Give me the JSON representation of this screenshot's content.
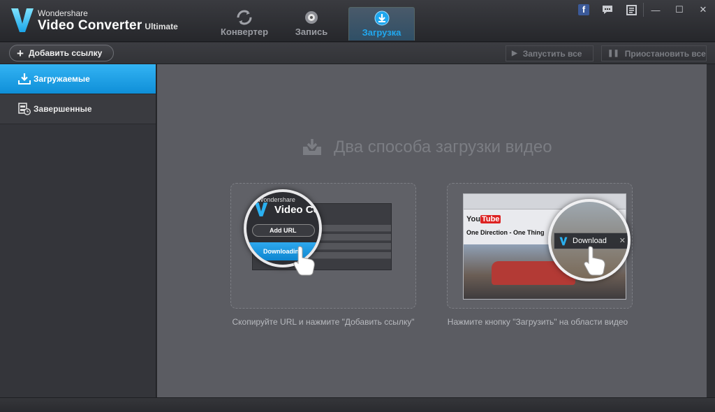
{
  "window": {
    "brand_small": "Wondershare",
    "brand_big": "Video Converter",
    "brand_edition": "Ultimate",
    "controls": {
      "facebook": "f",
      "minimize": "—",
      "maximize": "☐",
      "close": "✕"
    }
  },
  "tabs": [
    {
      "label": "Конвертер",
      "icon": "convert-icon",
      "active": false
    },
    {
      "label": "Запись",
      "icon": "record-icon",
      "active": false
    },
    {
      "label": "Загрузка",
      "icon": "download-icon",
      "active": true
    }
  ],
  "toolbar": {
    "add_link_label": "Добавить ссылку",
    "start_all_label": "Запустить все",
    "pause_all_label": "Приостановить все"
  },
  "sidebar": {
    "items": [
      {
        "label": "Загружаемые",
        "icon": "download-tray-icon",
        "active": true
      },
      {
        "label": "Завершенные",
        "icon": "film-clock-icon",
        "active": false
      }
    ]
  },
  "main": {
    "title": "Два способа загрузки видео",
    "way1": {
      "caption": "Скопируйте URL и нажмите \"Добавить ссылку\"",
      "ill_brand_small": "Wondershare",
      "ill_brand_big": "Video Co",
      "ill_add_url": "Add URL",
      "ill_downloading": "Downloading"
    },
    "way2": {
      "caption": "Нажмите кнопку \"Загрузить\" на области видео",
      "ill_you": "You",
      "ill_tube": "Tube",
      "ill_song": "One Direction - One Thing",
      "ill_download_btn": "Download",
      "ill_close": "✕"
    }
  },
  "colors": {
    "accent": "#1ea7ee",
    "background": "#5b5c62",
    "sidebar": "#34353a"
  }
}
